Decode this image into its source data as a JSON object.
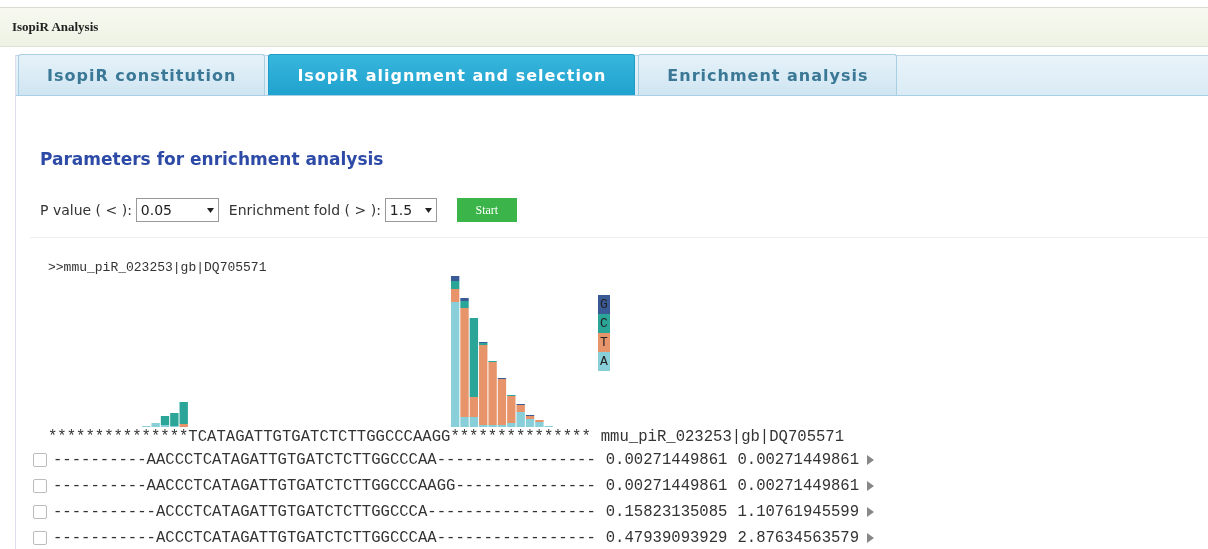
{
  "header": {
    "title": "IsopiR Analysis"
  },
  "tabs": [
    {
      "label": "IsopiR constitution",
      "selected": false
    },
    {
      "label": "IsopiR alignment and selection",
      "selected": true
    },
    {
      "label": "Enrichment analysis",
      "selected": false
    }
  ],
  "parameters": {
    "heading": "Parameters for enrichment analysis",
    "p_value": {
      "label": "P value ( < ):",
      "value": "0.05"
    },
    "enrichment_fold": {
      "label": "Enrichment fold ( > ):",
      "value": "1.5"
    },
    "start_button": "Start"
  },
  "alignment": {
    "title": ">>mmu_piR_023253|gb|DQ705571",
    "legend": [
      {
        "label": "G",
        "color": "#3a5a96"
      },
      {
        "label": "C",
        "color": "#2aa597"
      },
      {
        "label": "T",
        "color": "#e8946a"
      },
      {
        "label": "A",
        "color": "#88cfd9"
      }
    ],
    "reference": {
      "sequence": "***************TCATAGATTGTGATCTCTTGGCCCAAGG***************",
      "name": "mmu_piR_023253|gb|DQ705571"
    },
    "rows": [
      {
        "checked": false,
        "sequence": "----------AACCCTCATAGATTGTGATCTCTTGGCCCAA-----------------",
        "value_1": "0.00271449861",
        "value_2": "0.00271449861"
      },
      {
        "checked": false,
        "sequence": "----------AACCCTCATAGATTGTGATCTCTTGGCCCAAGG---------------",
        "value_1": "0.00271449861",
        "value_2": "0.00271449861"
      },
      {
        "checked": false,
        "sequence": "-----------ACCCTCATAGATTGTGATCTCTTGGCCCA------------------",
        "value_1": "0.15823135085",
        "value_2": "1.10761945599"
      },
      {
        "checked": false,
        "sequence": "-----------ACCCTCATAGATTGTGATCTCTTGGCCCAA-----------------",
        "value_1": "0.47939093929",
        "value_2": "2.87634563579"
      }
    ]
  }
}
